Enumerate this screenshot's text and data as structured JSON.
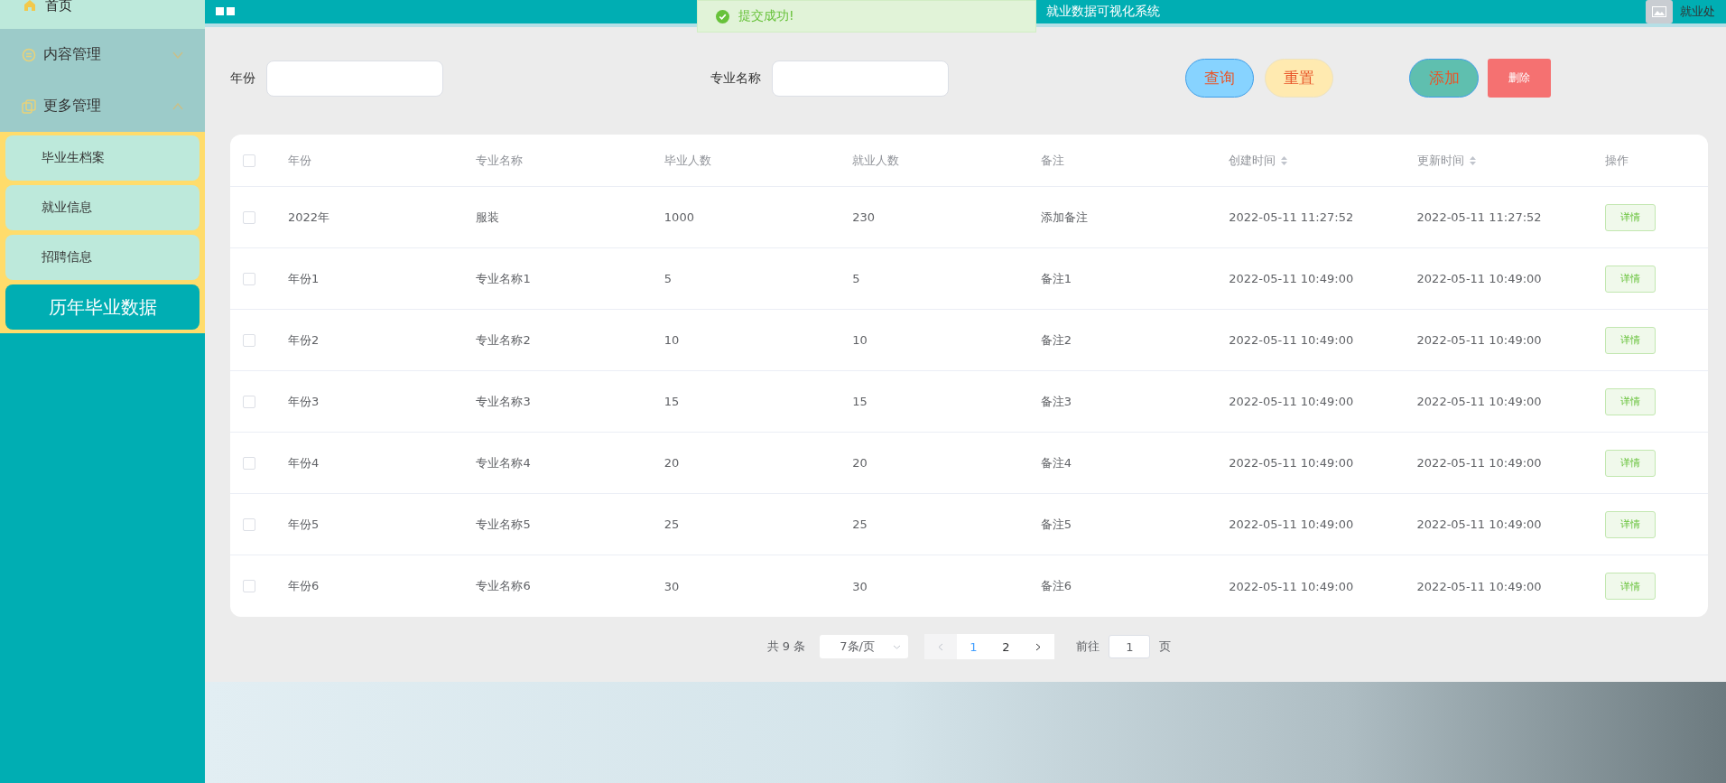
{
  "header": {
    "title": "就业数据可视化系统",
    "user": "就业处"
  },
  "toast": {
    "text": "提交成功!"
  },
  "sidebar": {
    "items": [
      {
        "label": "首页",
        "kind": "link"
      },
      {
        "label": "内容管理",
        "kind": "group",
        "expanded": false
      },
      {
        "label": "更多管理",
        "kind": "group",
        "expanded": true,
        "children": [
          {
            "label": "毕业生档案",
            "selected": false
          },
          {
            "label": "就业信息",
            "selected": false
          },
          {
            "label": "招聘信息",
            "selected": false
          },
          {
            "label": "历年毕业数据",
            "selected": true
          }
        ]
      }
    ]
  },
  "filters": [
    {
      "label": "年份"
    },
    {
      "label": "专业名称"
    }
  ],
  "buttons": [
    {
      "label": "查询",
      "kind": "query"
    },
    {
      "label": "重置",
      "kind": "reset"
    },
    {
      "label": "添加",
      "kind": "add"
    },
    {
      "label": "删除",
      "kind": "delete"
    }
  ],
  "table": {
    "all_checked": false,
    "columns": [
      {
        "label": "年份",
        "sortable": false
      },
      {
        "label": "专业名称",
        "sortable": false
      },
      {
        "label": "毕业人数",
        "sortable": false
      },
      {
        "label": "就业人数",
        "sortable": false
      },
      {
        "label": "备注",
        "sortable": false
      },
      {
        "label": "创建时间",
        "sortable": true
      },
      {
        "label": "更新时间",
        "sortable": true
      },
      {
        "label": "操作",
        "sortable": false
      }
    ],
    "rows": [
      {
        "checked": false,
        "cells": [
          "2022年",
          "服装",
          "1000",
          "230",
          "添加备注",
          "2022-05-11 11:27:52",
          "2022-05-11 11:27:52"
        ],
        "action": "详情"
      },
      {
        "checked": false,
        "cells": [
          "年份1",
          "专业名称1",
          "5",
          "5",
          "备注1",
          "2022-05-11 10:49:00",
          "2022-05-11 10:49:00"
        ],
        "action": "详情"
      },
      {
        "checked": false,
        "cells": [
          "年份2",
          "专业名称2",
          "10",
          "10",
          "备注2",
          "2022-05-11 10:49:00",
          "2022-05-11 10:49:00"
        ],
        "action": "详情"
      },
      {
        "checked": false,
        "cells": [
          "年份3",
          "专业名称3",
          "15",
          "15",
          "备注3",
          "2022-05-11 10:49:00",
          "2022-05-11 10:49:00"
        ],
        "action": "详情"
      },
      {
        "checked": false,
        "cells": [
          "年份4",
          "专业名称4",
          "20",
          "20",
          "备注4",
          "2022-05-11 10:49:00",
          "2022-05-11 10:49:00"
        ],
        "action": "详情"
      },
      {
        "checked": false,
        "cells": [
          "年份5",
          "专业名称5",
          "25",
          "25",
          "备注5",
          "2022-05-11 10:49:00",
          "2022-05-11 10:49:00"
        ],
        "action": "详情"
      },
      {
        "checked": false,
        "cells": [
          "年份6",
          "专业名称6",
          "30",
          "30",
          "备注6",
          "2022-05-11 10:49:00",
          "2022-05-11 10:49:00"
        ],
        "action": "详情"
      }
    ]
  },
  "pagination": {
    "total": "共 9 条",
    "page_size": "7条/页",
    "pages": [
      {
        "label": "1",
        "selected": true
      },
      {
        "label": "2",
        "selected": false
      }
    ],
    "goto_label": "前往",
    "goto_value": "1",
    "goto_suffix": "页"
  }
}
